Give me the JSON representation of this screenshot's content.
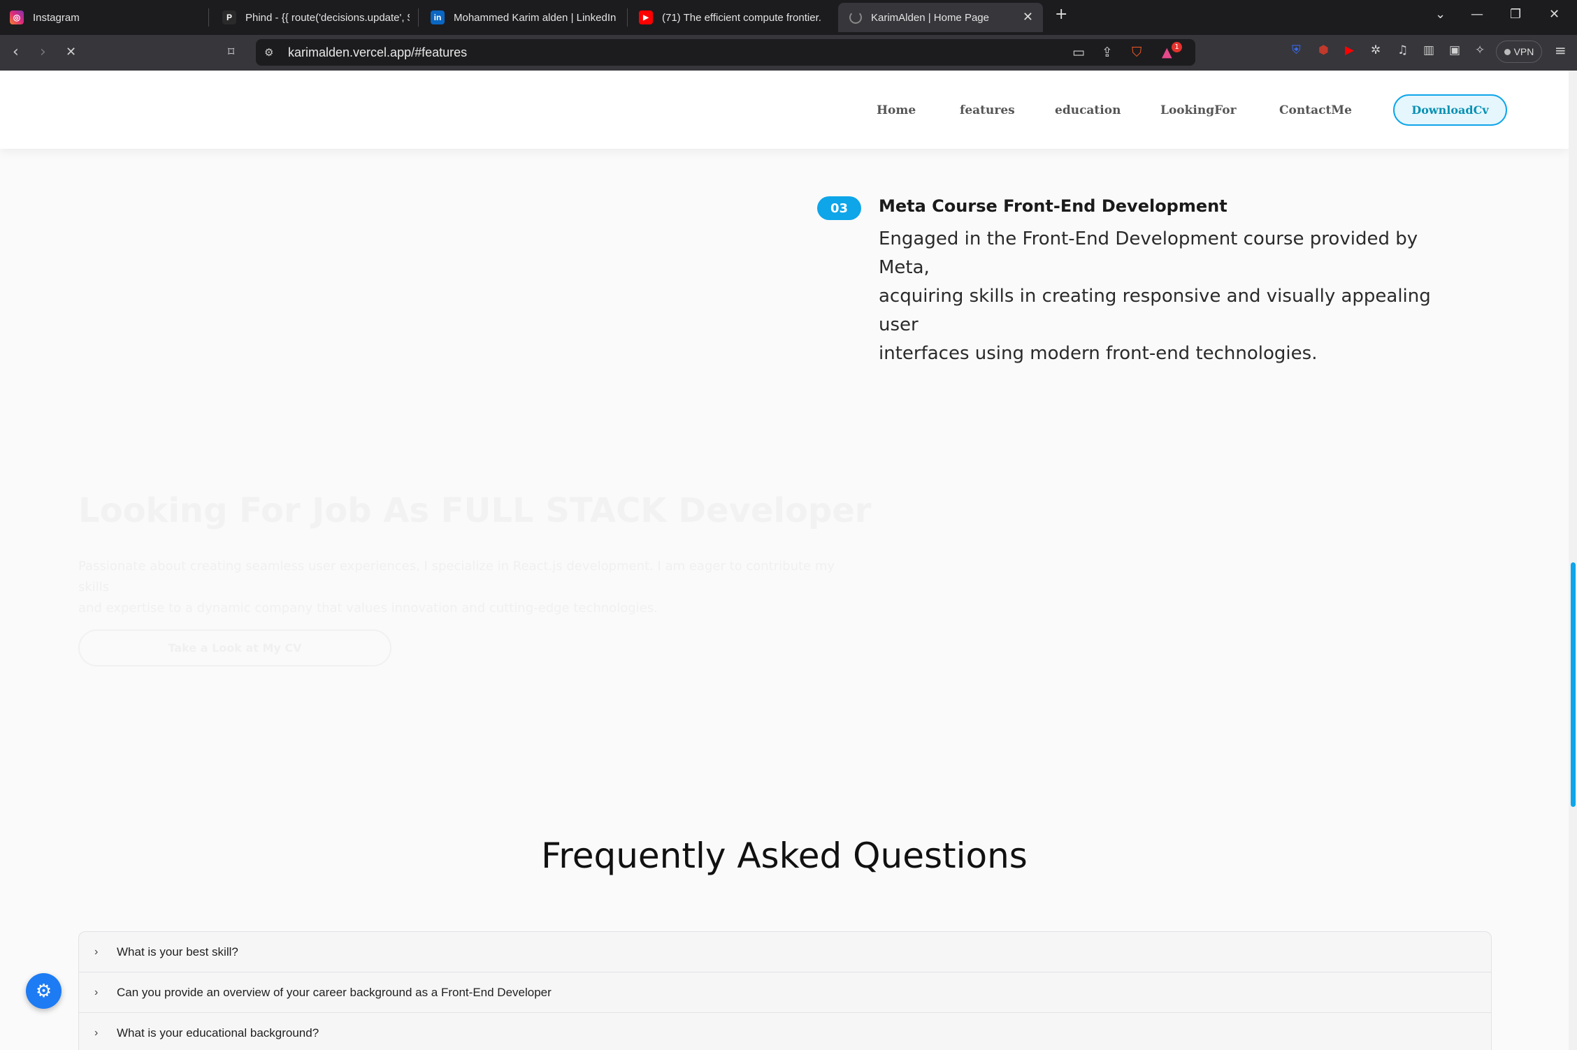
{
  "browser": {
    "tabs": [
      {
        "title": "Instagram",
        "icon": "instagram-icon",
        "color": "#e1306c"
      },
      {
        "title": "Phind - {{ route('decisions.update', $",
        "icon": "phind-icon",
        "color": "#2a2a2a"
      },
      {
        "title": "Mohammed Karim alden | LinkedIn",
        "icon": "linkedin-icon",
        "color": "#0a66c2"
      },
      {
        "title": "(71) The efficient compute frontier.",
        "icon": "youtube-icon",
        "color": "#ff0000"
      },
      {
        "title": "KarimAlden | Home Page",
        "icon": "loading-spinner-icon",
        "color": "#888888"
      }
    ],
    "url": "karimalden.vercel.app/#features",
    "vpn_label": "VPN",
    "notification_count": "1"
  },
  "header": {
    "nav": [
      "Home",
      "features",
      "education",
      "LookingFor",
      "ContactMe"
    ],
    "download_label": "DownloadCv",
    "accent": "#0ea5e9"
  },
  "education": {
    "number": "03",
    "title": "Meta Course Front-End Development",
    "lines": [
      "Engaged in the Front-End Development course provided by Meta,",
      "acquiring skills in creating responsive and visually appealing user",
      "interfaces using modern front-end technologies."
    ]
  },
  "looking_for": {
    "title": "Looking For Job As FULL STACK Developer",
    "lines": [
      "Passionate about creating seamless user experiences, I specialize in React.js development. I am eager to contribute my skills",
      "and expertise to a dynamic company that values innovation and cutting-edge technologies."
    ],
    "button_label": "Take a Look at My CV"
  },
  "faq": {
    "title": "Frequently Asked Questions",
    "items": [
      "What is your best skill?",
      "Can you provide an overview of your career background as a Front-End Developer",
      "What is your educational background?"
    ]
  }
}
